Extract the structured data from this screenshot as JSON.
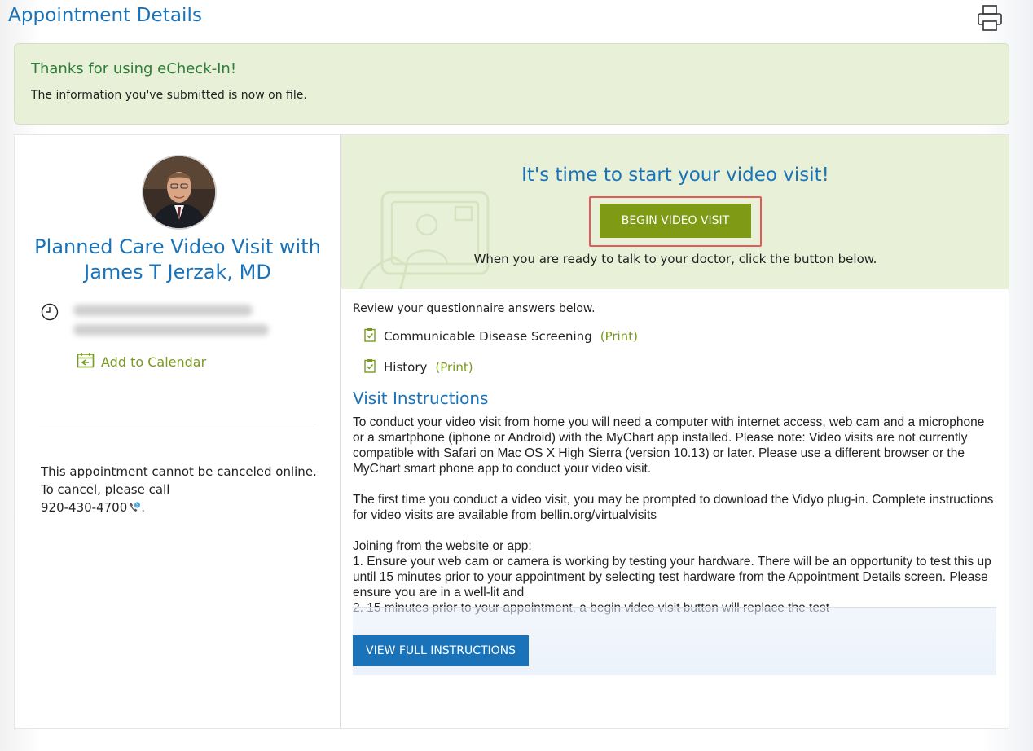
{
  "header": {
    "title": "Appointment Details",
    "print_icon": "printer-icon"
  },
  "banner": {
    "title": "Thanks for using eCheck-In!",
    "text": "The information you've submitted is now on file."
  },
  "appointment": {
    "visit_title": "Planned Care Video Visit with James T Jerzak, MD",
    "datetime_hidden": "blurred",
    "add_to_calendar": "Add to Calendar",
    "cancel_text": "This appointment cannot be canceled online. To cancel, please call",
    "phone": "920-430-4700",
    "phone_suffix": "."
  },
  "video": {
    "heading": "It's time to start your video visit!",
    "button": "BEGIN VIDEO VISIT",
    "subtext": "When you are ready to talk to your doctor, click the button below."
  },
  "questionnaires": {
    "intro": "Review your questionnaire answers below.",
    "items": [
      {
        "label": "Communicable Disease Screening",
        "print": "(Print)"
      },
      {
        "label": "History",
        "print": "(Print)"
      }
    ]
  },
  "instructions": {
    "title": "Visit Instructions",
    "para1": "To conduct your video visit from home you will need a computer with internet access, web cam and a microphone or a smartphone (iphone or Android) with the MyChart app installed. Please note: Video visits are not currently compatible with Safari on Mac OS X High Sierra (version 10.13) or later. Please use a different browser or the MyChart smart phone app to conduct your video visit.",
    "para2": "The first time you conduct a video visit, you may be prompted to download the Vidyo plug-in. Complete instructions for video visits are available from bellin.org/virtualvisits",
    "para3_heading": "Joining from the website or app:",
    "para3_step1": "1. Ensure your web cam or camera is working by testing your hardware. There will be an opportunity to test this up until 15 minutes prior to your appointment by selecting test hardware from the Appointment Details screen. Please ensure you are in a well-lit and",
    "para3_step2": "2. 15 minutes prior to your appointment, a begin video visit button will replace the test",
    "view_full": "VIEW FULL INSTRUCTIONS"
  },
  "colors": {
    "brand_blue": "#1a73b8",
    "accent_green": "#7f9a15",
    "banner_bg": "#e8f1d8",
    "highlight_red": "#e45a5a"
  }
}
